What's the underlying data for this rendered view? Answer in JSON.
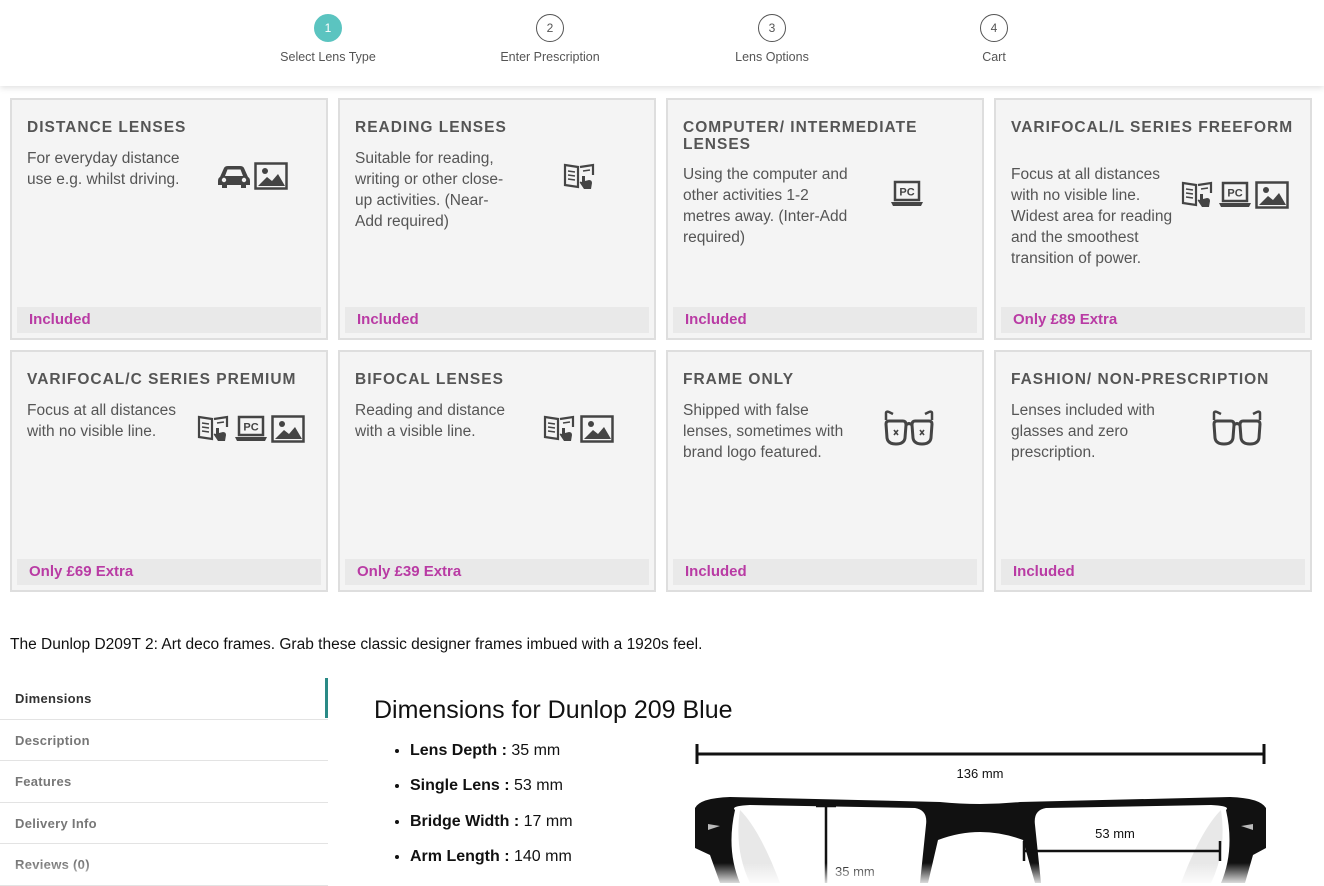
{
  "steps": [
    {
      "num": "1",
      "label": "Select Lens Type"
    },
    {
      "num": "2",
      "label": "Enter Prescription"
    },
    {
      "num": "3",
      "label": "Lens Options"
    },
    {
      "num": "4",
      "label": "Cart"
    }
  ],
  "lens_cards": [
    {
      "title": "DISTANCE LENSES",
      "desc": "For everyday distance use e.g. whilst driving.",
      "price": "Included",
      "icons": [
        "car-icon",
        "landscape-icon"
      ]
    },
    {
      "title": "READING LENSES",
      "desc": "Suitable for reading, writing or other close-up activities. (Near-Add required)",
      "price": "Included",
      "icons": [
        "book-hand-icon"
      ]
    },
    {
      "title": "COMPUTER/ INTERMEDIATE LENSES",
      "desc": "Using the computer and other activities 1-2 metres away. (Inter-Add required)",
      "price": "Included",
      "icons": [
        "laptop-pc-icon"
      ]
    },
    {
      "title": "VARIFOCAL/L SERIES FREEFORM",
      "desc": "Focus at all distances with no visible line. Widest area for reading and the smoothest transition of power.",
      "price": "Only £89 Extra",
      "icons": [
        "book-hand-icon",
        "laptop-pc-icon",
        "landscape-icon"
      ]
    },
    {
      "title": "VARIFOCAL/C SERIES PREMIUM",
      "desc": "Focus at all distances with no visible line.",
      "price": "Only £69 Extra",
      "icons": [
        "book-hand-icon",
        "laptop-pc-icon",
        "landscape-icon"
      ]
    },
    {
      "title": "BIFOCAL LENSES",
      "desc": "Reading and distance with a visible line.",
      "price": "Only £39 Extra",
      "icons": [
        "book-hand-icon",
        "landscape-icon"
      ]
    },
    {
      "title": "FRAME ONLY",
      "desc": "Shipped with false lenses, sometimes with brand logo featured.",
      "price": "Included",
      "icons": [
        "glasses-x-icon"
      ]
    },
    {
      "title": "FASHION/ NON-PRESCRIPTION",
      "desc": "Lenses included with glasses and zero prescription.",
      "price": "Included",
      "icons": [
        "glasses-icon"
      ]
    }
  ],
  "summary": "The Dunlop D209T 2: Art deco frames. Grab these classic designer frames imbued with a 1920s feel.",
  "tabs": [
    "Dimensions",
    "Description",
    "Features",
    "Delivery Info",
    "Reviews (0)"
  ],
  "dimensions": {
    "title": "Dimensions for Dunlop 209 Blue",
    "items": [
      {
        "label": "Lens Depth :",
        "value": " 35 mm"
      },
      {
        "label": "Single Lens :",
        "value": " 53 mm"
      },
      {
        "label": "Bridge Width :",
        "value": " 17 mm"
      },
      {
        "label": "Arm Length :",
        "value": " 140 mm"
      }
    ],
    "diagram": {
      "total_width": "136 mm",
      "lens_width": "53 mm",
      "lens_depth": "35 mm"
    }
  },
  "colors": {
    "accent": "#5bc4c0",
    "price": "#b93ba4",
    "tab_active": "#2a8a86"
  }
}
